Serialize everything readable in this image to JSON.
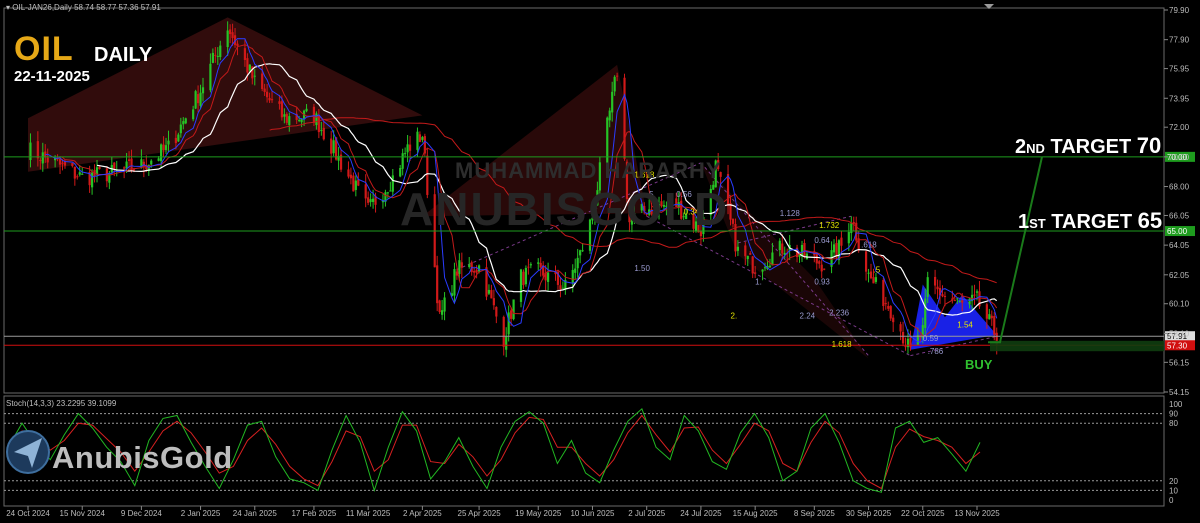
{
  "header": {
    "instrument": "OIL-JAN26,Daily",
    "ohlc": "58.74 58.77 57.36 57.91"
  },
  "brand": {
    "symbol": "OIL",
    "timeframe": "DAILY",
    "date": "22-11-2025",
    "logo": "AnubisGold",
    "watermark_line1": "MUHAMMAD HARARHY",
    "watermark_line2": "ANUBISGOLD"
  },
  "annotations": {
    "target2_prefix": "2",
    "target2_suffix": "ND",
    "target2_text": " TARGET ",
    "target2_value": "70",
    "target1_prefix": "1",
    "target1_suffix": "ST",
    "target1_text": " TARGET ",
    "target1_value": "65",
    "buy_label": "BUY"
  },
  "colors": {
    "background": "#000000",
    "bull": "#26c426",
    "bear": "#d11919",
    "ma_white": "#ffffff",
    "ma_red": "#c21a1a",
    "ma_blue": "#2a3cff",
    "target_line": "#1e9c1e",
    "support_line": "#d10f0f",
    "harmonic_fill": "#1c25ff",
    "stoch_k": "#22b722",
    "stoch_d": "#d62020",
    "brand_gold": "#e6a817"
  },
  "chart_data": [
    {
      "type": "candlestick",
      "instrument": "OIL-JAN26",
      "timeframe": "Daily",
      "ylim": [
        54.15,
        79.9
      ],
      "y_ticks": [
        "79.90",
        "77.90",
        "75.95",
        "73.95",
        "72.00",
        "70.00",
        "68.00",
        "66.05",
        "64.05",
        "62.05",
        "60.10",
        "58.10",
        "56.15",
        "54.15"
      ],
      "x_ticks": [
        "24 Oct 2024",
        "15 Nov 2024",
        "9 Dec 2024",
        "2 Jan 2025",
        "24 Jan 2025",
        "17 Feb 2025",
        "11 Mar 2025",
        "2 Apr 2025",
        "25 Apr 2025",
        "19 May 2025",
        "10 Jun 2025",
        "2 Jul 2025",
        "24 Jul 2025",
        "15 Aug 2025",
        "8 Sep 2025",
        "30 Sep 2025",
        "22 Oct 2025",
        "13 Nov 2025"
      ],
      "price_path": [
        [
          "24 Oct 2024",
          70.5
        ],
        [
          "4 Nov 2024",
          69.6
        ],
        [
          "15 Nov 2024",
          68.6
        ],
        [
          "27 Nov 2024",
          68.9
        ],
        [
          "9 Dec 2024",
          69.4
        ],
        [
          "20 Dec 2024",
          70.6
        ],
        [
          "2 Jan 2025",
          74.5
        ],
        [
          "13 Jan 2025",
          78.8
        ],
        [
          "24 Jan 2025",
          75.0
        ],
        [
          "5 Feb 2025",
          72.6
        ],
        [
          "17 Feb 2025",
          72.8
        ],
        [
          "28 Feb 2025",
          69.6
        ],
        [
          "11 Mar 2025",
          66.4
        ],
        [
          "21 Mar 2025",
          68.6
        ],
        [
          "27 Mar 2025",
          70.6
        ],
        [
          "2 Apr 2025",
          71.5
        ],
        [
          "9 Apr 2025",
          59.0
        ],
        [
          "16 Apr 2025",
          62.4
        ],
        [
          "25 Apr 2025",
          62.6
        ],
        [
          "5 May 2025",
          57.8
        ],
        [
          "12 May 2025",
          61.9
        ],
        [
          "19 May 2025",
          62.3
        ],
        [
          "30 May 2025",
          61.2
        ],
        [
          "5 Jun 2025",
          63.4
        ],
        [
          "10 Jun 2025",
          66.0
        ],
        [
          "16 Jun 2025",
          72.0
        ],
        [
          "20 Jun 2025",
          75.8
        ],
        [
          "25 Jun 2025",
          65.6
        ],
        [
          "2 Jul 2025",
          66.5
        ],
        [
          "14 Jul 2025",
          66.8
        ],
        [
          "24 Jul 2025",
          65.0
        ],
        [
          "30 Jul 2025",
          69.4
        ],
        [
          "8 Aug 2025",
          63.6
        ],
        [
          "15 Aug 2025",
          62.6
        ],
        [
          "27 Aug 2025",
          64.0
        ],
        [
          "8 Sep 2025",
          63.0
        ],
        [
          "12 Sep 2025",
          62.8
        ],
        [
          "19 Sep 2025",
          64.0
        ],
        [
          "23 Sep 2025",
          65.9
        ],
        [
          "30 Sep 2025",
          62.0
        ],
        [
          "10 Oct 2025",
          59.5
        ],
        [
          "17 Oct 2025",
          56.8
        ],
        [
          "22 Oct 2025",
          58.2
        ],
        [
          "24 Oct 2025",
          61.5
        ],
        [
          "31 Oct 2025",
          60.6
        ],
        [
          "7 Nov 2025",
          60.0
        ],
        [
          "13 Nov 2025",
          60.3
        ],
        [
          "21 Nov 2025",
          57.91
        ]
      ],
      "price_labels": {
        "current": "57.91",
        "support": "57.30",
        "target1": "65.00",
        "target2": "70.00"
      },
      "levels": [
        {
          "name": "2nd target",
          "value": 70.0
        },
        {
          "name": "1st target",
          "value": 65.0
        },
        {
          "name": "support",
          "value": 57.3
        }
      ],
      "fib_labels": [
        "1.618",
        "5",
        "0.56",
        "0.34",
        "1.50",
        "1.128",
        "1.732",
        "0.64",
        ".618",
        ".5",
        "1.",
        "0.93",
        "2.",
        "2.24",
        "2.236",
        "1.618",
        "0.59",
        ".786",
        "1.54"
      ]
    },
    {
      "type": "line",
      "title": "Stoch(14,3,3) 23.2295 39.1099",
      "indicator": "Stoch(14,3,3)",
      "k_value": 23.2295,
      "d_value": 39.1099,
      "ylim": [
        0,
        100
      ],
      "y_ticks": [
        "100",
        "90",
        "80",
        "20",
        "10",
        "0"
      ],
      "levels": [
        90,
        80,
        20,
        10
      ],
      "k_path": [
        55,
        80,
        58,
        42,
        68,
        90,
        75,
        55,
        40,
        15,
        62,
        85,
        88,
        60,
        35,
        12,
        42,
        78,
        82,
        45,
        22,
        18,
        10,
        52,
        88,
        60,
        10,
        55,
        92,
        72,
        22,
        40,
        65,
        35,
        12,
        55,
        82,
        92,
        80,
        38,
        62,
        28,
        18,
        52,
        82,
        95,
        55,
        42,
        88,
        72,
        40,
        32,
        70,
        90,
        65,
        20,
        30,
        75,
        90,
        60,
        20,
        12,
        8,
        75,
        82,
        60,
        65,
        48,
        30,
        60
      ],
      "d_path": [
        50,
        72,
        64,
        52,
        62,
        80,
        78,
        64,
        50,
        30,
        50,
        72,
        82,
        70,
        50,
        28,
        35,
        62,
        75,
        58,
        35,
        22,
        15,
        40,
        72,
        66,
        30,
        42,
        78,
        78,
        40,
        38,
        58,
        45,
        25,
        42,
        70,
        86,
        84,
        55,
        55,
        38,
        25,
        42,
        70,
        88,
        68,
        50,
        75,
        76,
        52,
        38,
        58,
        80,
        72,
        38,
        30,
        60,
        82,
        70,
        38,
        20,
        12,
        55,
        74,
        66,
        62,
        55,
        38,
        50
      ]
    }
  ]
}
